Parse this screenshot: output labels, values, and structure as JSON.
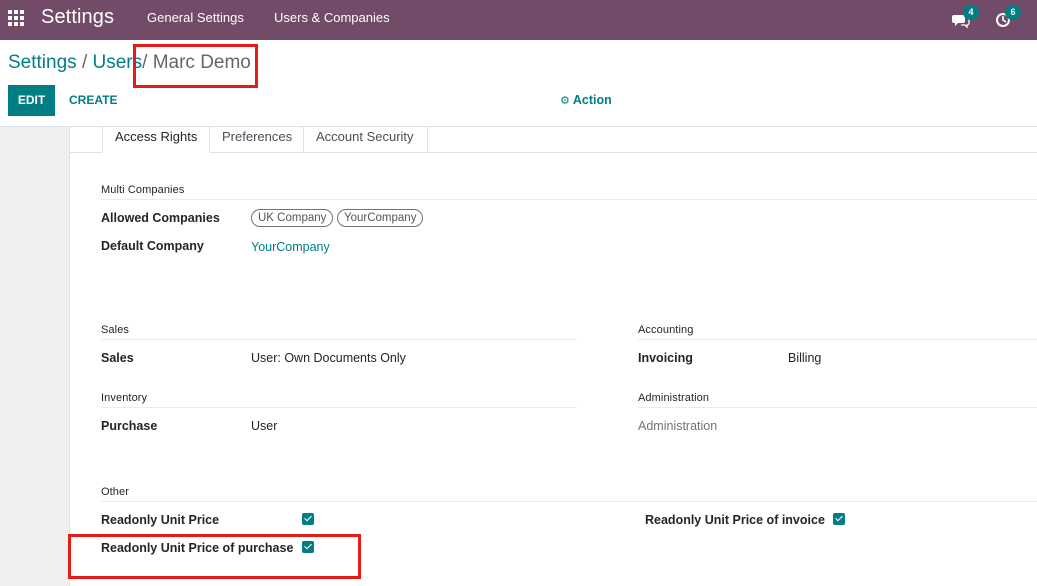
{
  "navbar": {
    "app_title": "Settings",
    "menus": [
      "General Settings",
      "Users & Companies"
    ],
    "messages_count": "4",
    "activities_count": "6"
  },
  "breadcrumb": {
    "root": "Settings",
    "sep1": "/",
    "parent": "Users",
    "sep2": "/",
    "current": "Marc Demo"
  },
  "toolbar": {
    "edit_label": "EDIT",
    "create_label": "CREATE",
    "action_label": "Action"
  },
  "tabs": [
    "Access Rights",
    "Preferences",
    "Account Security"
  ],
  "multi_companies": {
    "title": "Multi Companies",
    "allowed_label": "Allowed Companies",
    "allowed_tags": [
      "UK Company",
      "YourCompany"
    ],
    "default_label": "Default Company",
    "default_value": "YourCompany"
  },
  "sales": {
    "title": "Sales",
    "label": "Sales",
    "value": "User: Own Documents Only"
  },
  "accounting": {
    "title": "Accounting",
    "label": "Invoicing",
    "value": "Billing"
  },
  "inventory": {
    "title": "Inventory",
    "label": "Purchase",
    "value": "User"
  },
  "administration": {
    "title": "Administration",
    "value": "Administration"
  },
  "other": {
    "title": "Other",
    "readonly_unit_price_label": "Readonly Unit Price",
    "readonly_unit_price_checked": true,
    "readonly_invoice_label": "Readonly Unit Price of invoice",
    "readonly_invoice_checked": true,
    "readonly_purchase_label": "Readonly Unit Price of purchase",
    "readonly_purchase_checked": true
  },
  "colors": {
    "navbar": "#714b67",
    "accent": "#017e84",
    "highlight": "#e21b1b"
  }
}
